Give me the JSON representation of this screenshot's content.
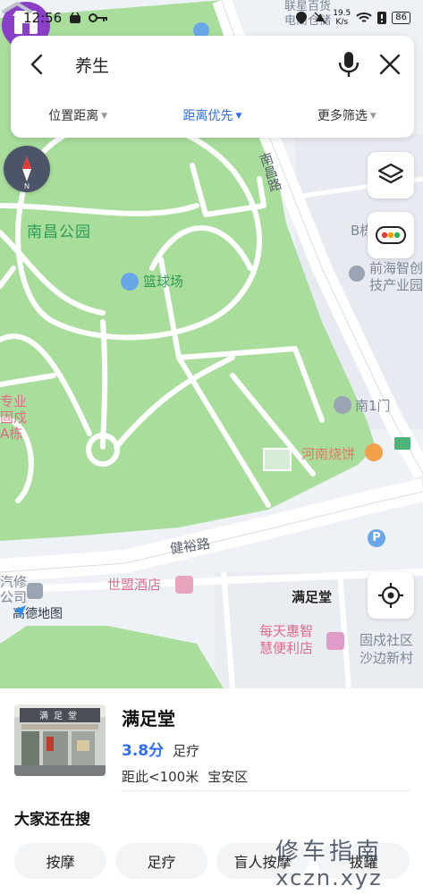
{
  "status_bar": {
    "time": "12:56",
    "network_speed_top": "19.5",
    "network_speed_bottom": "K/s",
    "battery": "86"
  },
  "search": {
    "query": "养生",
    "filters": [
      {
        "label": "位置距离",
        "active": false
      },
      {
        "label": "距离优先",
        "active": true
      },
      {
        "label": "更多筛选",
        "active": false
      }
    ]
  },
  "map": {
    "labels": {
      "park": "南昌公园",
      "road_nanchang": "南昌路",
      "road_jianyu": "健裕路",
      "basketball": "篮球场",
      "south_gate": "南1门",
      "henan_shaobing": "河南烧饼",
      "shimeng_hotel": "世盟酒店",
      "meitian": "每天惠智\n慧便利店",
      "gucheng": "固戍社区\n沙边新村",
      "qianhai": "前海智创\n技产业园",
      "lianxing": "联星百货\n电商仓储",
      "b_building": "B栋",
      "left_top": "专业\n固戍\nA栋",
      "left_bottom": "汽修\n公司",
      "logo": "高德地图"
    },
    "marker_label": "满足堂",
    "compass_letter": "N"
  },
  "place": {
    "name": "满足堂",
    "rating": "3.8分",
    "category": "足疗",
    "distance": "距此<100米",
    "district": "宝安区",
    "sign_text": "满足堂"
  },
  "also_search": {
    "title": "大家还在搜",
    "chips": [
      "按摩",
      "足疗",
      "盲人按摩",
      "拔罐"
    ]
  },
  "watermark": {
    "top": "修车指南",
    "bottom": "xczn.xyz"
  },
  "colors": {
    "park_green": "#a8dd9c",
    "accent_blue": "#2d6ef5",
    "marker_purple": "#8a3fc9"
  }
}
